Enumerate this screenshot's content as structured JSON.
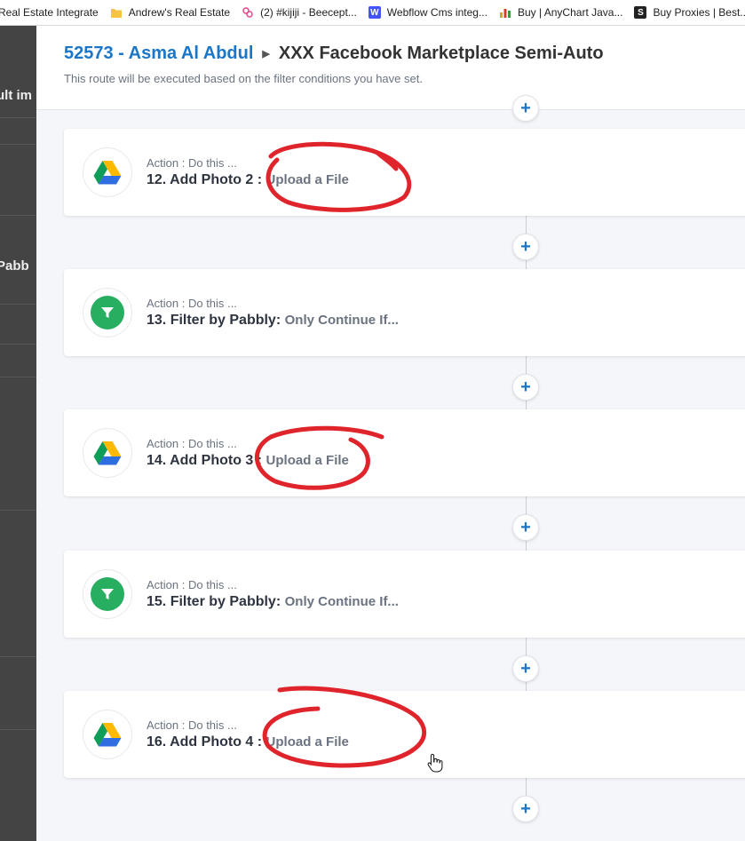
{
  "bookmarks": [
    {
      "label": "Real Estate Integrate",
      "icon": "none"
    },
    {
      "label": "Andrew's Real Estate",
      "icon": "folder-icon",
      "color": "#f6c445"
    },
    {
      "label": "(2) #kijiji - Beecept...",
      "icon": "zapier-icon",
      "color": "#e6468c"
    },
    {
      "label": "Webflow Cms integ...",
      "icon": "webflow-icon",
      "color": "#4353ff"
    },
    {
      "label": "Buy | AnyChart Java...",
      "icon": "anychart-icon",
      "color": "#e0a020"
    },
    {
      "label": "Buy Proxies | Best...",
      "icon": "s-icon",
      "color": "#222222"
    }
  ],
  "background_fragments": [
    "ult im",
    "Pabb"
  ],
  "header": {
    "workflow_id": "52573 - Asma Al Abdul",
    "route_name": "XXX Facebook Marketplace Semi-Auto",
    "subtitle": "This route will be executed based on the filter conditions you have set."
  },
  "steps": [
    {
      "label": "Action : Do this ...",
      "title": "12. Add Photo 2 :",
      "event": "Upload a File",
      "app": "google-drive"
    },
    {
      "label": "Action : Do this ...",
      "title": "13. Filter by Pabbly:",
      "event": "Only Continue If...",
      "app": "filter"
    },
    {
      "label": "Action : Do this ...",
      "title": "14. Add Photo 3 :",
      "event": "Upload a File",
      "app": "google-drive"
    },
    {
      "label": "Action : Do this ...",
      "title": "15. Filter by Pabbly:",
      "event": "Only Continue If...",
      "app": "filter"
    },
    {
      "label": "Action : Do this ...",
      "title": "16. Add Photo 4 :",
      "event": "Upload a File",
      "app": "google-drive"
    }
  ],
  "add_step_symbol": "+",
  "colors": {
    "accent": "#1a76c8",
    "annotation": "#e0242b",
    "filter": "#27ae60"
  }
}
